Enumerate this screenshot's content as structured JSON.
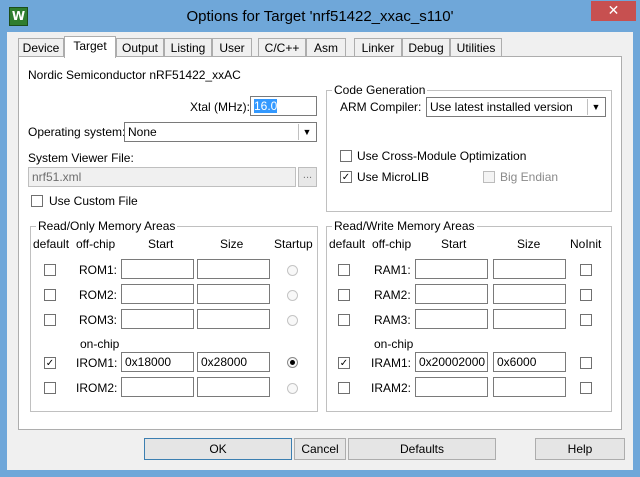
{
  "window": {
    "title": "Options for Target 'nrf51422_xxac_s110'",
    "close_glyph": "✕",
    "app_icon_glyph": "W"
  },
  "tabs": [
    {
      "label": "Device",
      "active": false
    },
    {
      "label": "Target",
      "active": true
    },
    {
      "label": "Output",
      "active": false
    },
    {
      "label": "Listing",
      "active": false
    },
    {
      "label": "User",
      "active": false
    },
    {
      "label": "C/C++",
      "active": false
    },
    {
      "label": "Asm",
      "active": false
    },
    {
      "label": "Linker",
      "active": false
    },
    {
      "label": "Debug",
      "active": false
    },
    {
      "label": "Utilities",
      "active": false
    }
  ],
  "target": {
    "device_name": "Nordic Semiconductor nRF51422_xxAC",
    "xtal_label": "Xtal (MHz):",
    "xtal_value": "16.0",
    "os_label": "Operating system:",
    "os_value": "None",
    "svf_label": "System Viewer File:",
    "svf_value": "nrf51.xml",
    "svf_browse": "...",
    "use_custom_file": "Use Custom File"
  },
  "codegen": {
    "title": "Code Generation",
    "compiler_label": "ARM Compiler:",
    "compiler_value": "Use latest installed version",
    "cross_module": "Use Cross-Module Optimization",
    "microlib": "Use MicroLIB",
    "big_endian": "Big Endian"
  },
  "ro_memory": {
    "title": "Read/Only Memory Areas",
    "headers": {
      "default": "default",
      "offchip": "off-chip",
      "start": "Start",
      "size": "Size",
      "startup": "Startup"
    },
    "onchip_label": "on-chip",
    "rows": [
      {
        "name": "ROM1:",
        "start": "",
        "size": "",
        "default": false,
        "startup": false
      },
      {
        "name": "ROM2:",
        "start": "",
        "size": "",
        "default": false,
        "startup": false
      },
      {
        "name": "ROM3:",
        "start": "",
        "size": "",
        "default": false,
        "startup": false
      },
      {
        "name": "IROM1:",
        "start": "0x18000",
        "size": "0x28000",
        "default": true,
        "startup": true
      },
      {
        "name": "IROM2:",
        "start": "",
        "size": "",
        "default": false,
        "startup": false
      }
    ]
  },
  "rw_memory": {
    "title": "Read/Write Memory Areas",
    "headers": {
      "default": "default",
      "offchip": "off-chip",
      "start": "Start",
      "size": "Size",
      "noinit": "NoInit"
    },
    "onchip_label": "on-chip",
    "rows": [
      {
        "name": "RAM1:",
        "start": "",
        "size": "",
        "default": false,
        "noinit": false
      },
      {
        "name": "RAM2:",
        "start": "",
        "size": "",
        "default": false,
        "noinit": false
      },
      {
        "name": "RAM3:",
        "start": "",
        "size": "",
        "default": false,
        "noinit": false
      },
      {
        "name": "IRAM1:",
        "start": "0x20002000",
        "size": "0x6000",
        "default": true,
        "noinit": false
      },
      {
        "name": "IRAM2:",
        "start": "",
        "size": "",
        "default": false,
        "noinit": false
      }
    ]
  },
  "buttons": {
    "ok": "OK",
    "cancel": "Cancel",
    "defaults": "Defaults",
    "help": "Help"
  },
  "glyphs": {
    "check": "✓",
    "dropdown_arrow": "▼"
  }
}
